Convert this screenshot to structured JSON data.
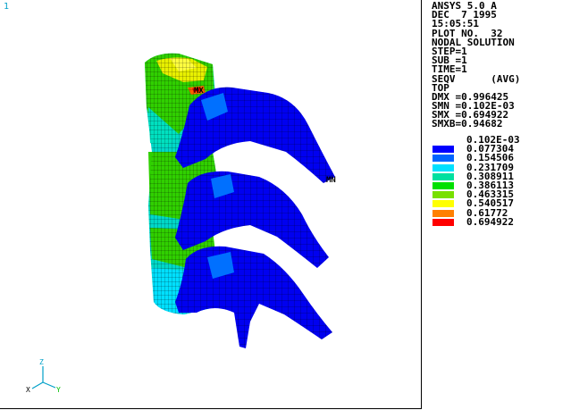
{
  "window_number": "1",
  "info_lines": [
    "ANSYS 5.0 A",
    "DEC  7 1995",
    "15:05:51",
    "PLOT NO.  32",
    "NODAL SOLUTION",
    "STEP=1",
    "SUB =1",
    "TIME=1",
    "SEQV      (AVG)",
    "TOP",
    "DMX =0.996425",
    "SMN =0.102E-03",
    "SMX =0.694922",
    "SMXB=0.94682"
  ],
  "legend_top": "0.102E-03",
  "legend": [
    {
      "value": "0.077304",
      "color": "#0000ff"
    },
    {
      "value": "0.154506",
      "color": "#0064ff"
    },
    {
      "value": "0.231709",
      "color": "#00e0ff"
    },
    {
      "value": "0.308911",
      "color": "#00e0a0"
    },
    {
      "value": "0.386113",
      "color": "#00e000"
    },
    {
      "value": "0.463315",
      "color": "#78e000"
    },
    {
      "value": "0.540517",
      "color": "#ffff00"
    },
    {
      "value": "0.61772",
      "color": "#ff8000"
    },
    {
      "value": "0.694922",
      "color": "#ff0000"
    }
  ],
  "markers": {
    "max": "MX",
    "min": "MN"
  },
  "triad": {
    "z": "Z",
    "y": "Y",
    "x": "X"
  }
}
